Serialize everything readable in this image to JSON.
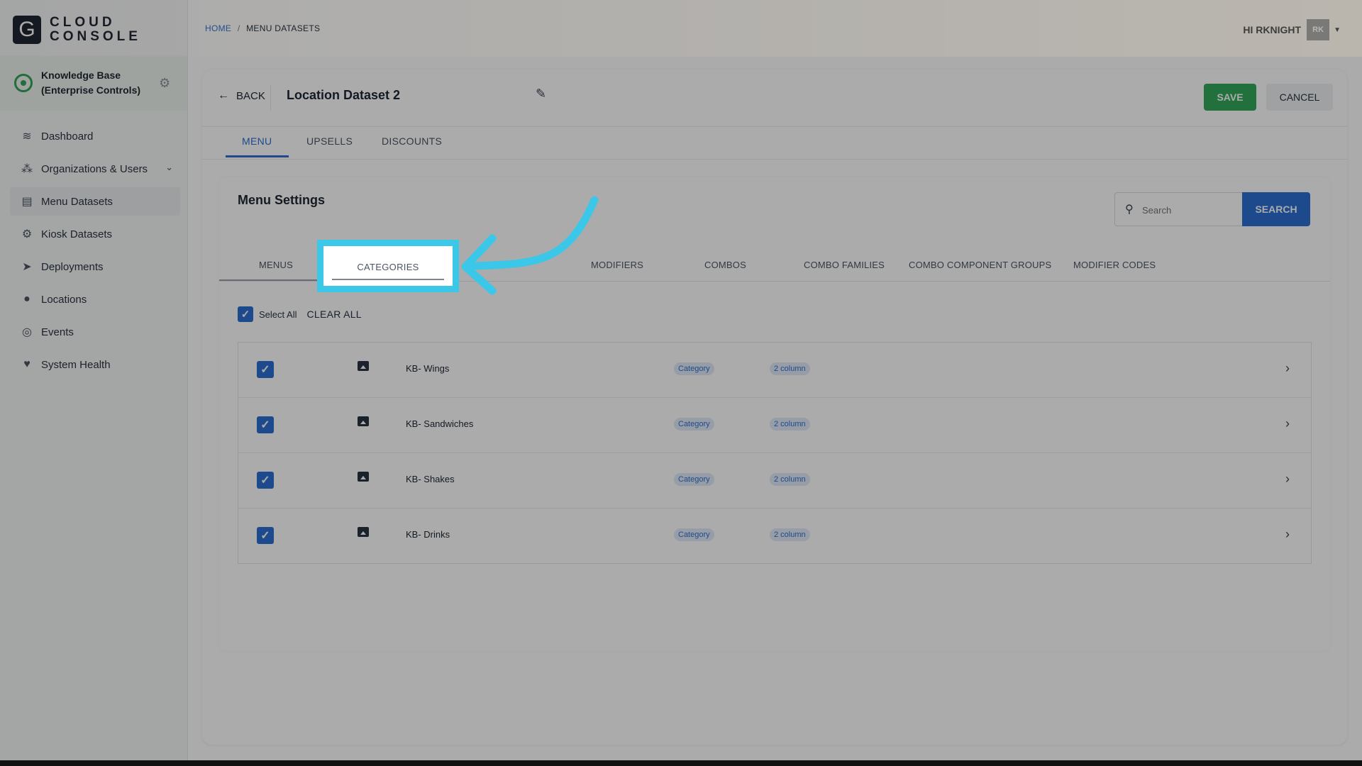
{
  "app": {
    "logo_letter": "G",
    "logo_line1": "CLOUD",
    "logo_line2": "CONSOLE"
  },
  "org": {
    "name_line1": "Knowledge Base",
    "name_line2": "(Enterprise Controls)"
  },
  "sidebar": {
    "items": [
      {
        "label": "Dashboard",
        "icon": "layers-icon"
      },
      {
        "label": "Organizations & Users",
        "icon": "org-tree-icon"
      },
      {
        "label": "Menu Datasets",
        "icon": "menu-dataset-icon",
        "active": true
      },
      {
        "label": "Kiosk Datasets",
        "icon": "gear-icon"
      },
      {
        "label": "Deployments",
        "icon": "send-icon"
      },
      {
        "label": "Locations",
        "icon": "pin-icon"
      },
      {
        "label": "Events",
        "icon": "aperture-icon"
      },
      {
        "label": "System Health",
        "icon": "heart-pulse-icon"
      }
    ]
  },
  "header": {
    "breadcrumb_home": "HOME",
    "breadcrumb_sep": "/",
    "breadcrumb_current": "MENU DATASETS",
    "greeting": "HI RKNIGHT",
    "avatar_initials": "RK"
  },
  "card": {
    "back_label": "BACK",
    "title": "Location Dataset 2",
    "save_label": "SAVE",
    "cancel_label": "CANCEL",
    "tabs": [
      "MENU",
      "UPSELLS",
      "DISCOUNTS"
    ],
    "active_tab": "MENU"
  },
  "settings": {
    "title": "Menu Settings",
    "search_placeholder": "Search",
    "search_button": "SEARCH",
    "sub_tabs": [
      "MENUS",
      "CATEGORIES",
      "MODIFIERS",
      "COMBOS",
      "COMBO FAMILIES",
      "COMBO COMPONENT GROUPS",
      "MODIFIER CODES"
    ],
    "highlighted_tab": "CATEGORIES",
    "select_all_label": "Select All",
    "clear_all_label": "CLEAR ALL"
  },
  "categories": [
    {
      "name": "KB- Wings",
      "type": "Category",
      "layout": "2 column",
      "checked": true
    },
    {
      "name": "KB- Sandwiches",
      "type": "Category",
      "layout": "2 column",
      "checked": true
    },
    {
      "name": "KB- Shakes",
      "type": "Category",
      "layout": "2 column",
      "checked": true
    },
    {
      "name": "KB- Drinks",
      "type": "Category",
      "layout": "2 column",
      "checked": true
    }
  ],
  "colors": {
    "primary": "#2c6fd1",
    "save_green": "#34a85a",
    "highlight_cyan": "#3bc8e8"
  }
}
